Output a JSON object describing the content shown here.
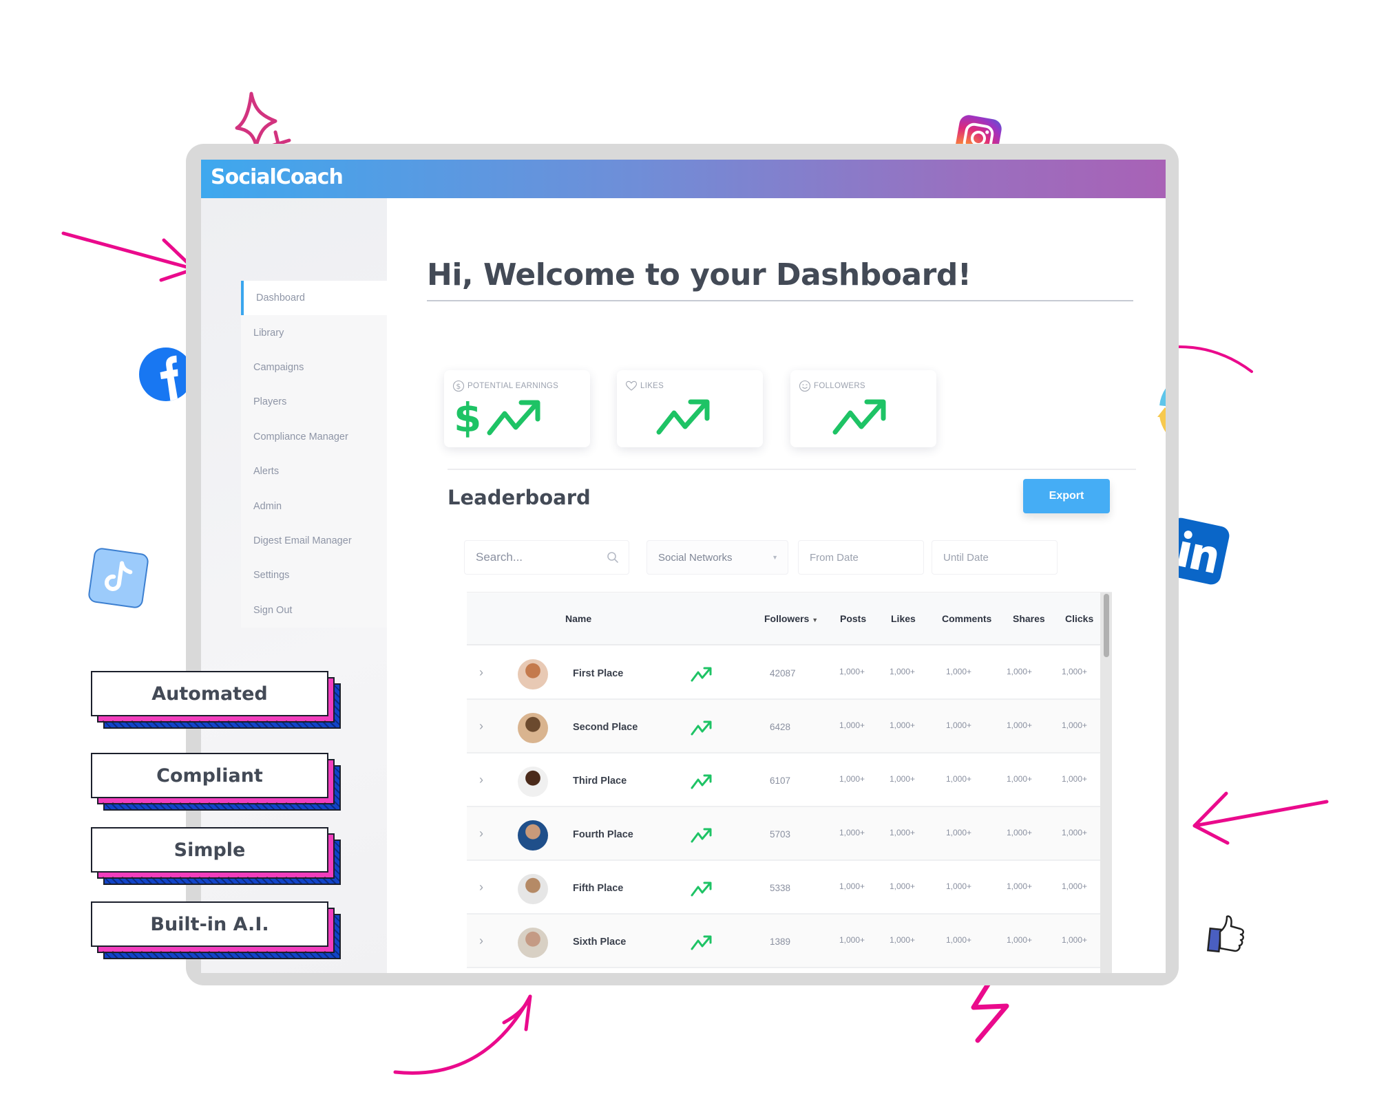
{
  "app": {
    "logo": "SocialCoach",
    "header_gradient": [
      "#3ea8ee",
      "#a862b6"
    ]
  },
  "sidebar": {
    "active_color": "#3aa6ee",
    "items": [
      {
        "label": "Dashboard",
        "active": true
      },
      {
        "label": "Library",
        "active": false
      },
      {
        "label": "Campaigns",
        "active": false
      },
      {
        "label": "Players",
        "active": false
      },
      {
        "label": "Compliance Manager",
        "active": false
      },
      {
        "label": "Alerts",
        "active": false
      },
      {
        "label": "Admin",
        "active": false
      },
      {
        "label": "Digest Email Manager",
        "active": false
      },
      {
        "label": "Settings",
        "active": false
      },
      {
        "label": "Sign Out",
        "active": false
      }
    ]
  },
  "main": {
    "welcome": "Hi, Welcome to your Dashboard!",
    "cards": [
      {
        "icon": "dollar-circle-icon",
        "label": "POTENTIAL EARNINGS",
        "value_symbol": "$",
        "trend": "up"
      },
      {
        "icon": "heart-icon",
        "label": "LIKES",
        "trend": "up"
      },
      {
        "icon": "smile-icon",
        "label": "FOLLOWERS",
        "trend": "up"
      }
    ],
    "cycle_colors": [
      "#5ec5ea",
      "#f26b5f",
      "#72ae5e",
      "#f7c94e"
    ],
    "trend_color": "#1ec365"
  },
  "leaderboard": {
    "title": "Leaderboard",
    "export_label": "Export",
    "export_color": "#45adf5",
    "filters": {
      "search_placeholder": "Search...",
      "network_select": "Social Networks",
      "from_placeholder": "From Date",
      "until_placeholder": "Until Date"
    },
    "columns": [
      "Name",
      "Followers",
      "Posts",
      "Likes",
      "Comments",
      "Shares",
      "Clicks"
    ],
    "sort_column": "Followers",
    "rows": [
      {
        "name": "First Place",
        "followers": "42087",
        "posts": "1,000+",
        "likes": "1,000+",
        "comments": "1,000+",
        "shares": "1,000+",
        "clicks": "1,000+"
      },
      {
        "name": "Second Place",
        "followers": "6428",
        "posts": "1,000+",
        "likes": "1,000+",
        "comments": "1,000+",
        "shares": "1,000+",
        "clicks": "1,000+"
      },
      {
        "name": "Third Place",
        "followers": "6107",
        "posts": "1,000+",
        "likes": "1,000+",
        "comments": "1,000+",
        "shares": "1,000+",
        "clicks": "1,000+"
      },
      {
        "name": "Fourth Place",
        "followers": "5703",
        "posts": "1,000+",
        "likes": "1,000+",
        "comments": "1,000+",
        "shares": "1,000+",
        "clicks": "1,000+"
      },
      {
        "name": "Fifth Place",
        "followers": "5338",
        "posts": "1,000+",
        "likes": "1,000+",
        "comments": "1,000+",
        "shares": "1,000+",
        "clicks": "1,000+"
      },
      {
        "name": "Sixth Place",
        "followers": "1389",
        "posts": "1,000+",
        "likes": "1,000+",
        "comments": "1,000+",
        "shares": "1,000+",
        "clicks": "1,000+"
      }
    ]
  },
  "features": [
    "Automated",
    "Compliant",
    "Simple",
    "Built-in A.I."
  ],
  "decorations": {
    "accent_pink": "#ea0a8c",
    "social_icons": [
      "instagram-icon",
      "facebook-icon",
      "tiktok-icon",
      "linkedin-icon",
      "thumbs-up-icon"
    ]
  }
}
